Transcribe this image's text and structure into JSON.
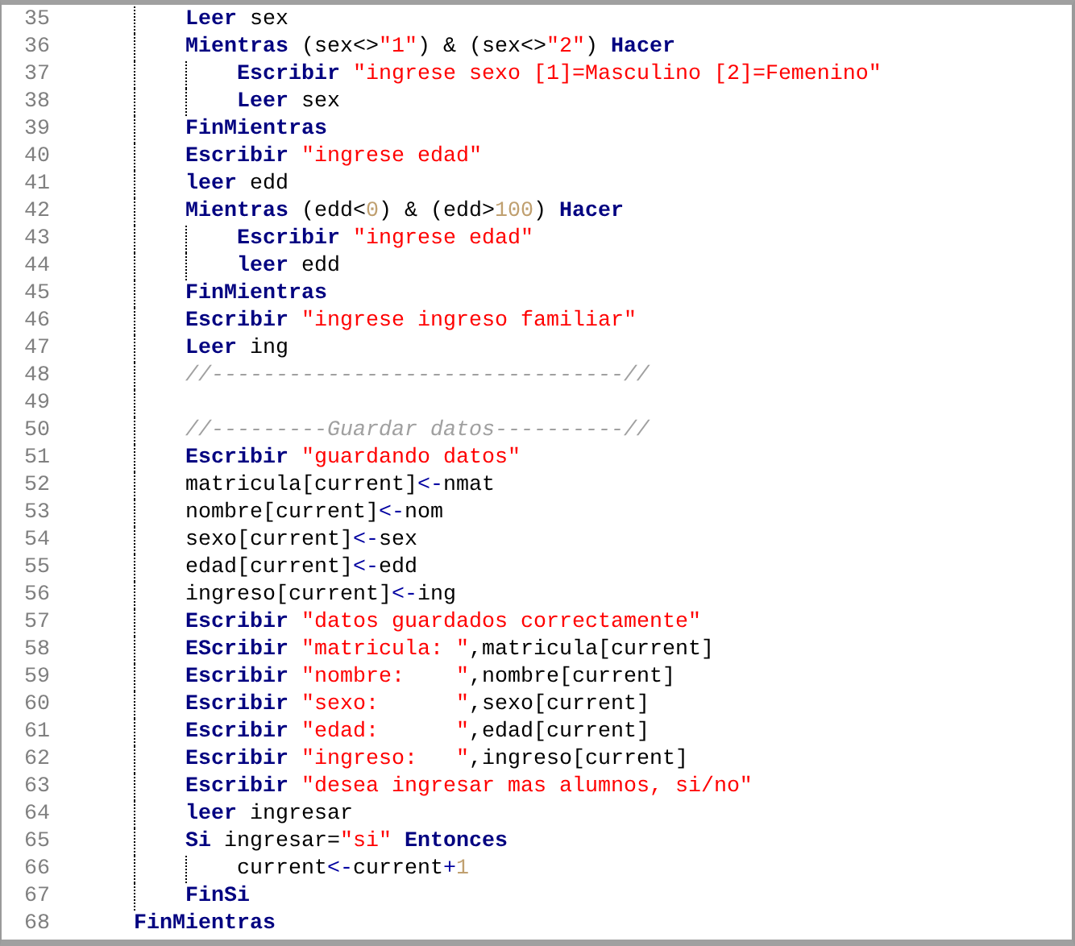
{
  "lines": [
    {
      "number": "35",
      "tokens": [
        {
          "kind": "keyword",
          "text": "        Leer"
        },
        {
          "kind": "plain",
          "text": " sex"
        }
      ]
    },
    {
      "number": "36",
      "tokens": [
        {
          "kind": "keyword",
          "text": "        Mientras"
        },
        {
          "kind": "plain",
          "text": " (sex<>"
        },
        {
          "kind": "string",
          "text": "\"1\""
        },
        {
          "kind": "plain",
          "text": ") & (sex<>"
        },
        {
          "kind": "string",
          "text": "\"2\""
        },
        {
          "kind": "plain",
          "text": ") "
        },
        {
          "kind": "keyword",
          "text": "Hacer"
        }
      ]
    },
    {
      "number": "37",
      "tokens": [
        {
          "kind": "keyword",
          "text": "            Escribir"
        },
        {
          "kind": "string",
          "text": " \"ingrese sexo [1]=Masculino [2]=Femenino\""
        }
      ]
    },
    {
      "number": "38",
      "tokens": [
        {
          "kind": "keyword",
          "text": "            Leer"
        },
        {
          "kind": "plain",
          "text": " sex"
        }
      ]
    },
    {
      "number": "39",
      "tokens": [
        {
          "kind": "keyword",
          "text": "        FinMientras"
        }
      ]
    },
    {
      "number": "40",
      "tokens": [
        {
          "kind": "keyword",
          "text": "        Escribir"
        },
        {
          "kind": "string",
          "text": " \"ingrese edad\""
        }
      ]
    },
    {
      "number": "41",
      "tokens": [
        {
          "kind": "keyword",
          "text": "        leer"
        },
        {
          "kind": "plain",
          "text": " edd"
        }
      ]
    },
    {
      "number": "42",
      "tokens": [
        {
          "kind": "keyword",
          "text": "        Mientras"
        },
        {
          "kind": "plain",
          "text": " (edd<"
        },
        {
          "kind": "number",
          "text": "0"
        },
        {
          "kind": "plain",
          "text": ") & (edd>"
        },
        {
          "kind": "number",
          "text": "100"
        },
        {
          "kind": "plain",
          "text": ") "
        },
        {
          "kind": "keyword",
          "text": "Hacer"
        }
      ]
    },
    {
      "number": "43",
      "tokens": [
        {
          "kind": "keyword",
          "text": "            Escribir"
        },
        {
          "kind": "string",
          "text": " \"ingrese edad\""
        }
      ]
    },
    {
      "number": "44",
      "tokens": [
        {
          "kind": "keyword",
          "text": "            leer"
        },
        {
          "kind": "plain",
          "text": " edd"
        }
      ]
    },
    {
      "number": "45",
      "tokens": [
        {
          "kind": "keyword",
          "text": "        FinMientras"
        }
      ]
    },
    {
      "number": "46",
      "tokens": [
        {
          "kind": "keyword",
          "text": "        Escribir"
        },
        {
          "kind": "string",
          "text": " \"ingrese ingreso familiar\""
        }
      ]
    },
    {
      "number": "47",
      "tokens": [
        {
          "kind": "keyword",
          "text": "        Leer"
        },
        {
          "kind": "plain",
          "text": " ing"
        }
      ]
    },
    {
      "number": "48",
      "tokens": [
        {
          "kind": "comment",
          "text": "        //--------------------------------//"
        }
      ]
    },
    {
      "number": "49"
    },
    {
      "number": "50",
      "tokens": [
        {
          "kind": "comment",
          "text": "        //---------Guardar datos----------//"
        }
      ]
    },
    {
      "number": "51",
      "tokens": [
        {
          "kind": "keyword",
          "text": "        Escribir"
        },
        {
          "kind": "string",
          "text": " \"guardando datos\""
        }
      ]
    },
    {
      "number": "52",
      "tokens": [
        {
          "kind": "plain",
          "text": "        matricula[current]"
        },
        {
          "kind": "operator",
          "text": "<-"
        },
        {
          "kind": "plain",
          "text": "nmat"
        }
      ]
    },
    {
      "number": "53",
      "tokens": [
        {
          "kind": "plain",
          "text": "        nombre[current]"
        },
        {
          "kind": "operator",
          "text": "<-"
        },
        {
          "kind": "plain",
          "text": "nom"
        }
      ]
    },
    {
      "number": "54",
      "tokens": [
        {
          "kind": "plain",
          "text": "        sexo[current]"
        },
        {
          "kind": "operator",
          "text": "<-"
        },
        {
          "kind": "plain",
          "text": "sex"
        }
      ]
    },
    {
      "number": "55",
      "tokens": [
        {
          "kind": "plain",
          "text": "        edad[current]"
        },
        {
          "kind": "operator",
          "text": "<-"
        },
        {
          "kind": "plain",
          "text": "edd"
        }
      ]
    },
    {
      "number": "56",
      "tokens": [
        {
          "kind": "plain",
          "text": "        ingreso[current]"
        },
        {
          "kind": "operator",
          "text": "<-"
        },
        {
          "kind": "plain",
          "text": "ing"
        }
      ]
    },
    {
      "number": "57",
      "tokens": [
        {
          "kind": "keyword",
          "text": "        Escribir"
        },
        {
          "kind": "string",
          "text": " \"datos guardados correctamente\""
        }
      ]
    },
    {
      "number": "58",
      "tokens": [
        {
          "kind": "keyword",
          "text": "        EScribir"
        },
        {
          "kind": "string",
          "text": " \"matricula: \""
        },
        {
          "kind": "plain",
          "text": ",matricula[current]"
        }
      ]
    },
    {
      "number": "59",
      "tokens": [
        {
          "kind": "keyword",
          "text": "        Escribir"
        },
        {
          "kind": "string",
          "text": " \"nombre:    \""
        },
        {
          "kind": "plain",
          "text": ",nombre[current]"
        }
      ]
    },
    {
      "number": "60",
      "tokens": [
        {
          "kind": "keyword",
          "text": "        Escribir"
        },
        {
          "kind": "string",
          "text": " \"sexo:      \""
        },
        {
          "kind": "plain",
          "text": ",sexo[current]"
        }
      ]
    },
    {
      "number": "61",
      "tokens": [
        {
          "kind": "keyword",
          "text": "        Escribir"
        },
        {
          "kind": "string",
          "text": " \"edad:      \""
        },
        {
          "kind": "plain",
          "text": ",edad[current]"
        }
      ]
    },
    {
      "number": "62",
      "tokens": [
        {
          "kind": "keyword",
          "text": "        Escribir"
        },
        {
          "kind": "string",
          "text": " \"ingreso:   \""
        },
        {
          "kind": "plain",
          "text": ",ingreso[current]"
        }
      ]
    },
    {
      "number": "63",
      "tokens": [
        {
          "kind": "keyword",
          "text": "        Escribir"
        },
        {
          "kind": "string",
          "text": " \"desea ingresar mas alumnos, si/no\""
        }
      ]
    },
    {
      "number": "64",
      "tokens": [
        {
          "kind": "keyword",
          "text": "        leer"
        },
        {
          "kind": "plain",
          "text": " ingresar"
        }
      ]
    },
    {
      "number": "65",
      "tokens": [
        {
          "kind": "keyword",
          "text": "        Si"
        },
        {
          "kind": "plain",
          "text": " ingresar="
        },
        {
          "kind": "string",
          "text": "\"si\""
        },
        {
          "kind": "keyword",
          "text": " Entonces"
        }
      ]
    },
    {
      "number": "66",
      "tokens": [
        {
          "kind": "plain",
          "text": "            current"
        },
        {
          "kind": "operator",
          "text": "<-"
        },
        {
          "kind": "plain",
          "text": "current"
        },
        {
          "kind": "operator",
          "text": "+"
        },
        {
          "kind": "number",
          "text": "1"
        }
      ]
    },
    {
      "number": "67",
      "tokens": [
        {
          "kind": "keyword",
          "text": "        FinSi"
        }
      ]
    },
    {
      "number": "68",
      "tokens": [
        {
          "kind": "keyword",
          "text": "    FinMientras"
        }
      ]
    }
  ]
}
